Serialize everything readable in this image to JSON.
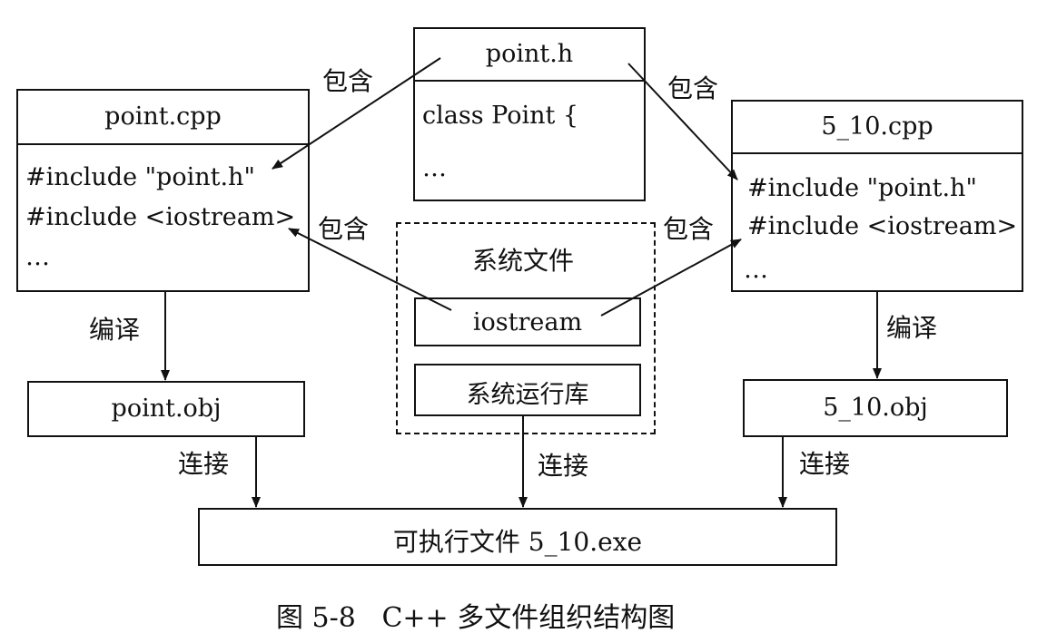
{
  "point_h": {
    "title": "point.h",
    "lines": [
      "class Point {",
      "…"
    ]
  },
  "point_cpp": {
    "title": "point.cpp",
    "lines": [
      "#include \"point.h\"",
      "#include <iostream>",
      "…"
    ]
  },
  "main_cpp": {
    "title": "5_10.cpp",
    "lines": [
      "#include \"point.h\"",
      "#include <iostream>",
      "…"
    ]
  },
  "system": {
    "title": "系统文件",
    "iostream": "iostream",
    "runtime": "系统运行库"
  },
  "point_obj": "point.obj",
  "main_obj": "5_10.obj",
  "exe": "可执行文件 5_10.exe",
  "labels": {
    "include": "包含",
    "compile": "编译",
    "link": "连接"
  },
  "caption": "图 5-8   C++ 多文件组织结构图"
}
